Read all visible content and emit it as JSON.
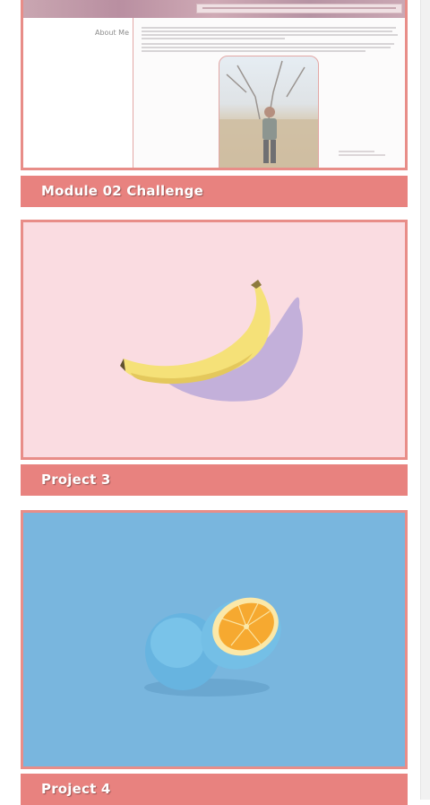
{
  "projects": [
    {
      "title": "Module 02 Challenge",
      "image": "about-me-page-screenshot",
      "heading": "About Me"
    },
    {
      "title": "Project 3",
      "image": "banana-photo"
    },
    {
      "title": "Project 4",
      "image": "orange-photo"
    }
  ],
  "colors": {
    "label_background": "#e8827f",
    "frame_border": "#e88d88",
    "banana_background": "#fadce1",
    "orange_background": "#79b6de"
  }
}
